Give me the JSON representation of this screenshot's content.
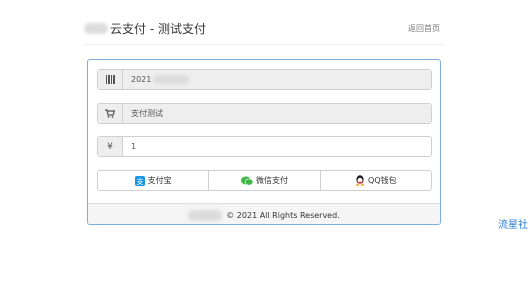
{
  "header": {
    "title": "云支付 - 测试支付",
    "home_link": "返回首页"
  },
  "form": {
    "order_field": {
      "icon": "barcode-icon",
      "value": "2021"
    },
    "product_field": {
      "icon": "cart-icon",
      "value": "支付测试"
    },
    "amount_field": {
      "icon": "yen-icon",
      "value": "1"
    }
  },
  "payment_methods": [
    {
      "label": "支付宝",
      "icon": "alipay-icon",
      "color": "#1a97e0"
    },
    {
      "label": "微信支付",
      "icon": "wechat-icon",
      "color": "#44b549"
    },
    {
      "label": "QQ钱包",
      "icon": "qq-icon",
      "color": "#222222"
    }
  ],
  "footer": {
    "copyright": "© 2021 All Rights Reserved."
  },
  "side_text": "流星社",
  "colors": {
    "panel_border": "#7eaee0",
    "link_blue": "#2a7ad2"
  }
}
